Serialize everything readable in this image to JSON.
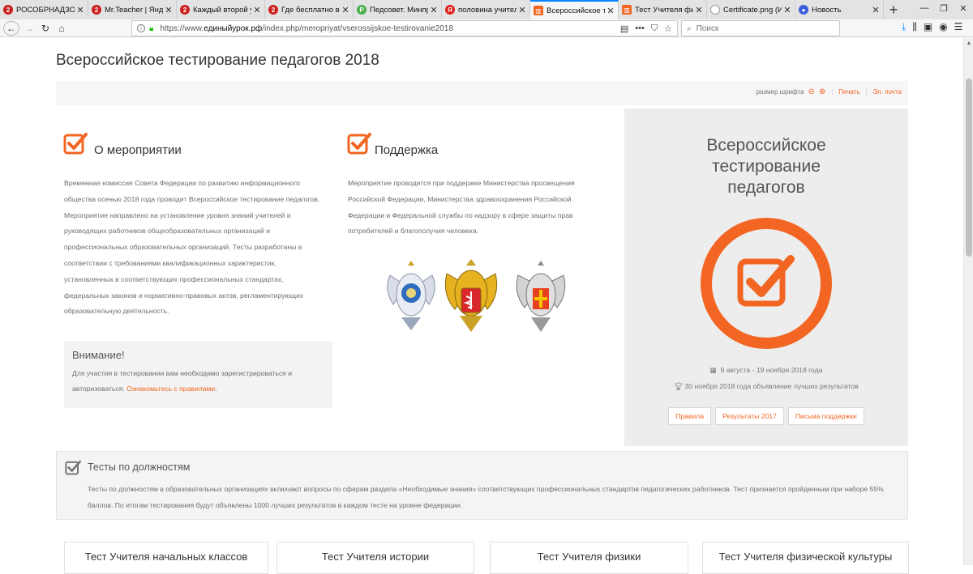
{
  "browser": {
    "tabs": [
      {
        "label": "РОСОБРНАДЗОР в Ш",
        "favicon_color": "#cc1f1f",
        "favicon_glyph": "2",
        "active": false
      },
      {
        "label": "Mr.Teacher | Яндекс",
        "favicon_color": "#cc1f1f",
        "favicon_glyph": "2",
        "active": false
      },
      {
        "label": "Каждый второй учи",
        "favicon_color": "#cc1f1f",
        "favicon_glyph": "2",
        "active": false
      },
      {
        "label": "Где бесплатно взять",
        "favicon_color": "#cc1f1f",
        "favicon_glyph": "2",
        "active": false
      },
      {
        "label": "Педсовет. Минпрос",
        "favicon_color": "#4caf50",
        "favicon_glyph": "P",
        "active": false
      },
      {
        "label": "половина учителей",
        "favicon_color": "#e0201b",
        "favicon_glyph": "Я",
        "active": false
      },
      {
        "label": "Всероссийское тест",
        "favicon_color": "#f26522",
        "favicon_glyph": "▥",
        "active": true
      },
      {
        "label": "Тест Учителя физи",
        "favicon_color": "#f26522",
        "favicon_glyph": "▥",
        "active": false
      },
      {
        "label": "Certificate.png (Изобра",
        "favicon_color": "#ffffff",
        "favicon_glyph": "",
        "active": false
      },
      {
        "label": "Новость",
        "favicon_color": "#3b5bdb",
        "favicon_glyph": "●",
        "active": false
      }
    ],
    "url_prefix": "https://www.",
    "url_domain": "единыйурок.рф",
    "url_path": "/index.php/meropriyat/vserossijskoe-testirovanie2018",
    "search_placeholder": "Поиск"
  },
  "page": {
    "title": "Всероссийское тестирование педагогов 2018",
    "toolstrip": {
      "font_size_label": "размер шрифта",
      "print_label": "Печать",
      "email_label": "Эл. почта"
    },
    "about": {
      "heading": "О мероприятии",
      "paragraph": "Временная комиссия Совета Федерации по развитию информационного общества осенью 2018 года проводит Всероссийское тестирование педагогов. Мероприятие направлено на установление уровня знаний учителей и руководящих работников общеобразовательных организаций и профессиональных образовательных организаций. Тесты разработаны в соответствии с требованиями квалификационных характеристик, установленных в соответствующих профессиональных стандартах, федеральных законов и нормативно-правовых актов, регламентирующих образовательную деятельность."
    },
    "attention": {
      "heading": "Внимание!",
      "text": "Для участия в тестировании вам необходимо зарегистрироваться и авторизоваться.",
      "link": "Ознакомьтесь с правилами",
      "suffix": "."
    },
    "support": {
      "heading": "Поддержка",
      "paragraph": "Мероприятие проводится при поддержке Министерства просвещения Российской Федерации, Министерства здравоохранения Российской Федерации и Федеральной службы по надзору в сфере защиты прав потребителей и благополучия человека."
    },
    "event": {
      "title": "Всероссийское тестирование педагогов",
      "dates": "9 августа - 19 ноября 2018 года",
      "results_announce": "30 ноября 2018 года объявление лучших результатов",
      "buttons": [
        "Правила",
        "Результаты 2017",
        "Письма поддержки"
      ]
    },
    "tests_block": {
      "heading": "Тесты по должностям",
      "text": "Тесты по должностям в образовательных организациях включают вопросы по сферам раздела «Необходимые знания» соответствующих профессиональных стандартов педагогических работников. Тест признается пройденным при наборе 55% баллов. По итогам тестирования будут объявлены 1000 лучших результатов в каждом тесте на уровне федерации."
    },
    "test_cards": [
      "Тест Учителя начальных классов",
      "Тест Учителя истории",
      "Тест Учителя физики",
      "Тест Учителя физической культуры"
    ]
  },
  "colors": {
    "accent": "#f26522",
    "panel_bg": "#ededed"
  }
}
